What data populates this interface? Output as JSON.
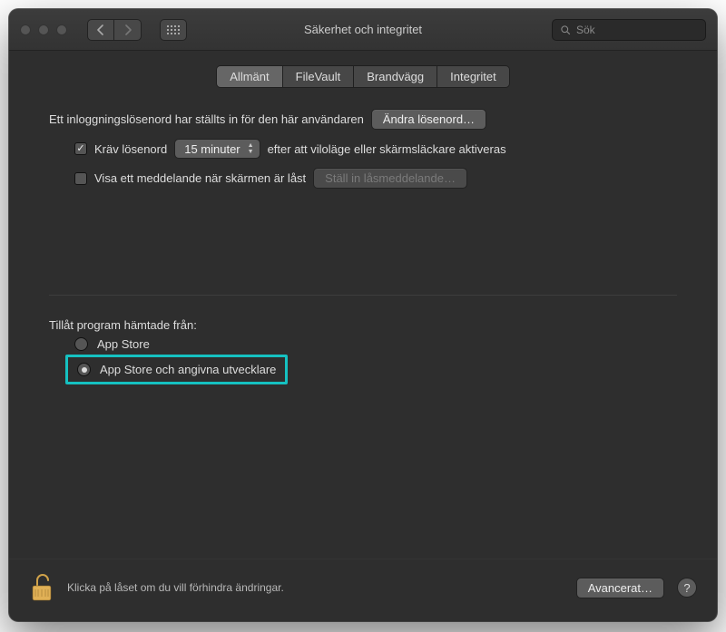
{
  "window": {
    "title": "Säkerhet och integritet"
  },
  "search": {
    "placeholder": "Sök"
  },
  "tabs": [
    {
      "label": "Allmänt",
      "selected": true
    },
    {
      "label": "FileVault",
      "selected": false
    },
    {
      "label": "Brandvägg",
      "selected": false
    },
    {
      "label": "Integritet",
      "selected": false
    }
  ],
  "general": {
    "password_set_text": "Ett inloggningslösenord har ställts in för den här användaren",
    "change_password_label": "Ändra lösenord…",
    "require_pw_label": "Kräv lösenord",
    "require_pw_select": "15 minuter",
    "require_pw_after": "efter att viloläge eller skärmsläckare aktiveras",
    "show_msg_label": "Visa ett meddelande när skärmen är låst",
    "set_lock_msg_label": "Ställ in låsmeddelande…",
    "allow_apps_heading": "Tillåt program hämtade från:",
    "radio_appstore": "App Store",
    "radio_identified": "App Store och angivna utvecklare"
  },
  "footer": {
    "lock_hint": "Klicka på låset om du vill förhindra ändringar.",
    "advanced_label": "Avancerat…"
  },
  "colors": {
    "highlight": "#15c1c1"
  }
}
